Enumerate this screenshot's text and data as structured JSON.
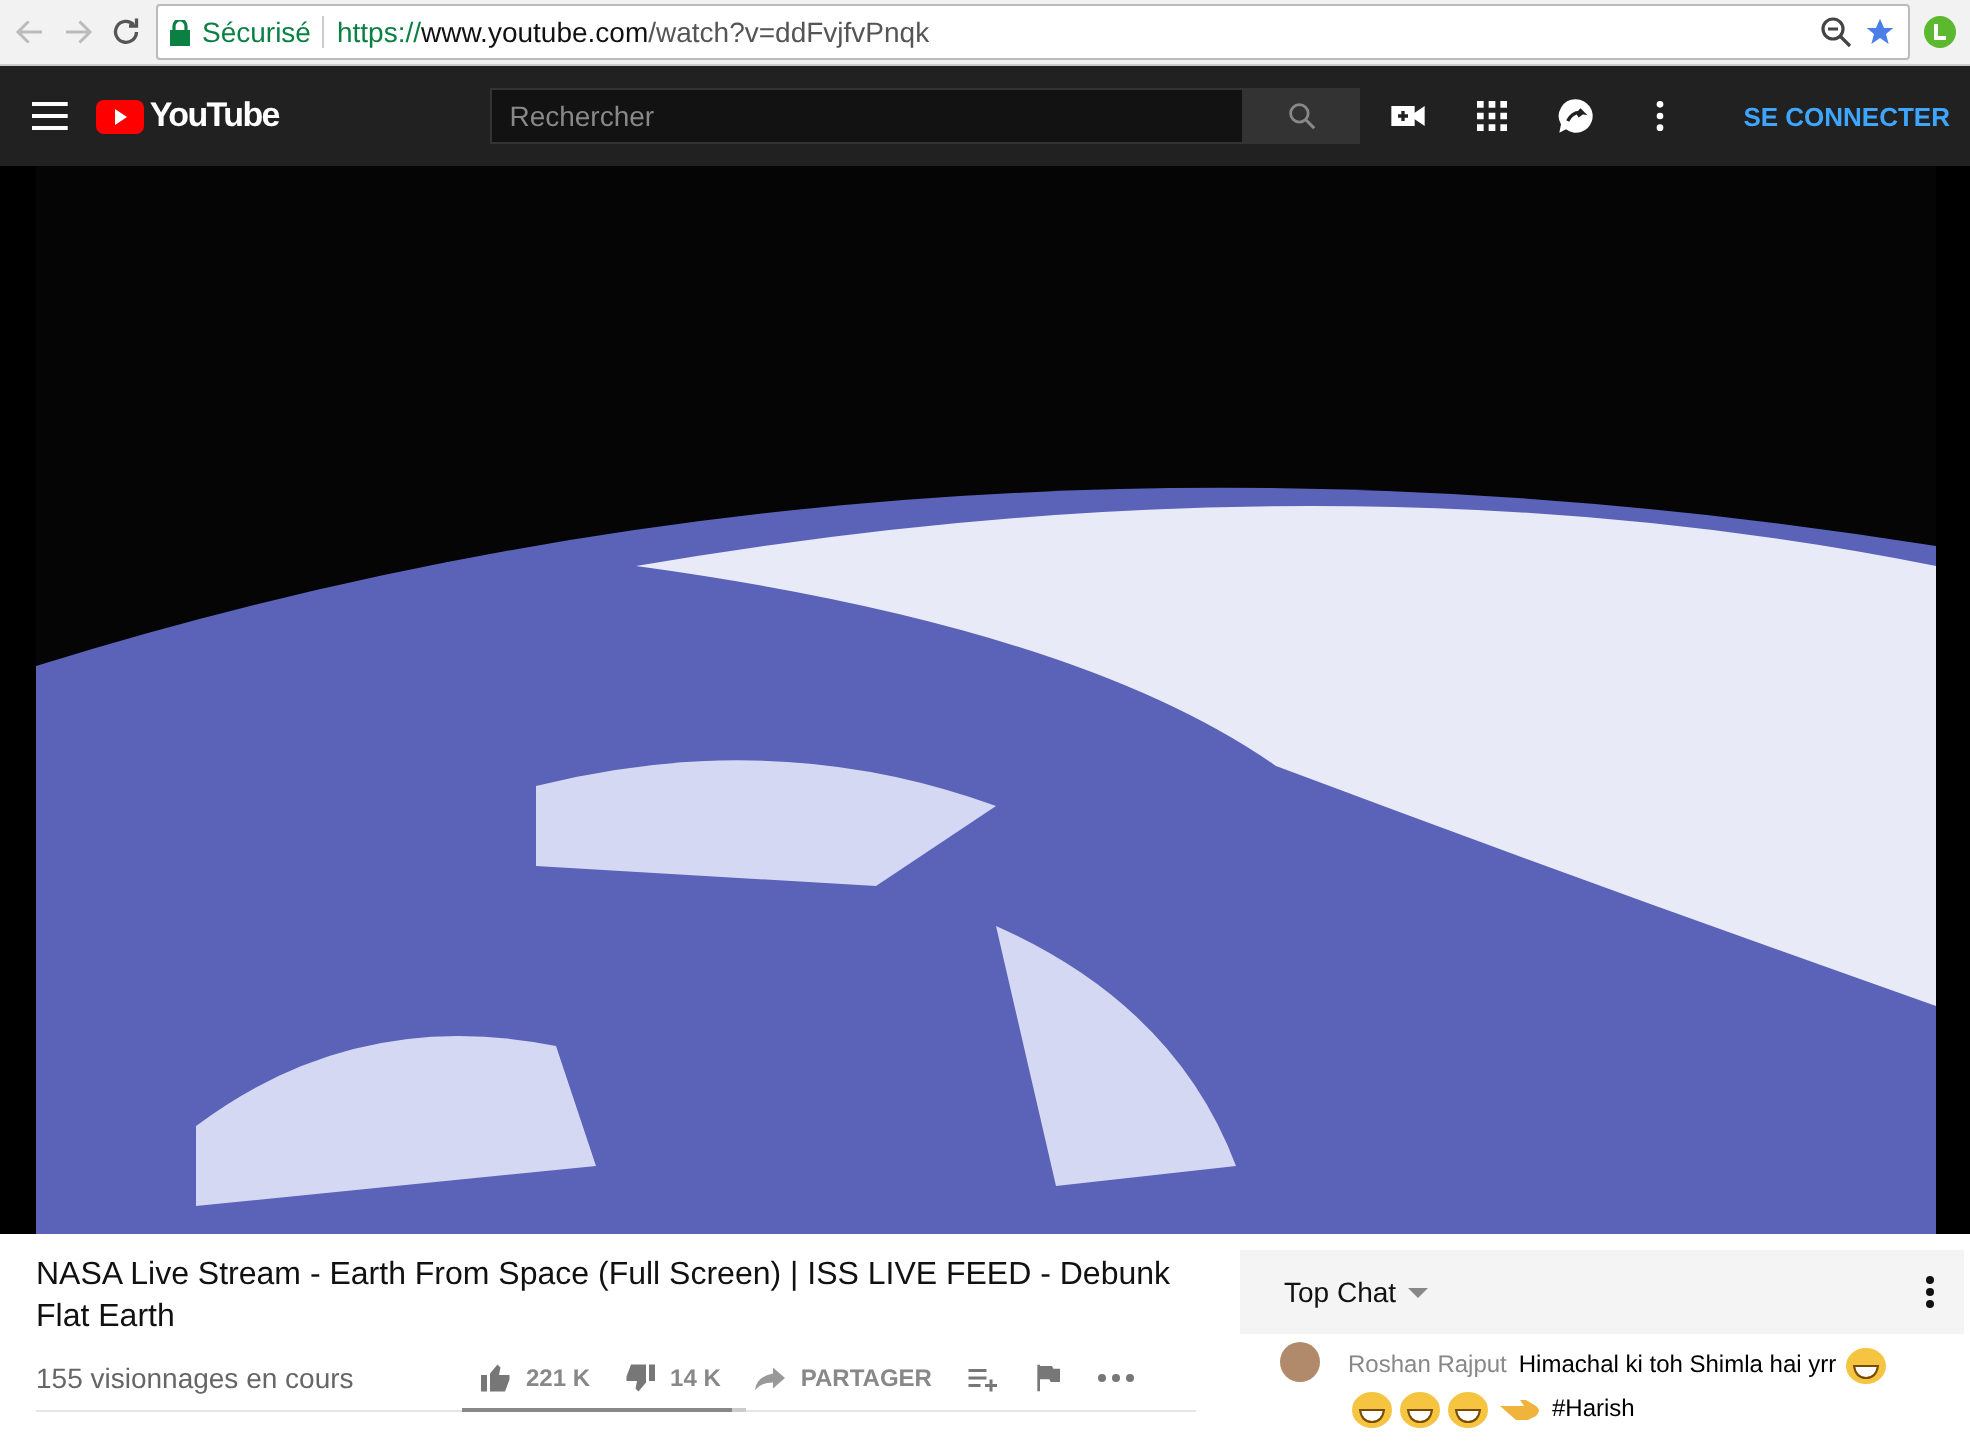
{
  "browser": {
    "secure_label": "Sécurisé",
    "url_scheme": "https://",
    "url_host": "www.youtube.com",
    "url_path": "/watch?v=ddFvjfvPnqk"
  },
  "header": {
    "logo": "YouTube",
    "search": {
      "placeholder": "Rechercher"
    },
    "sign_in": "SE CONNECTER"
  },
  "video": {
    "title": "NASA Live Stream - Earth From Space (Full Screen) | ISS LIVE FEED - Debunk Flat Earth",
    "views": "155 visionnages en cours",
    "likes": "221 K",
    "dislikes": "14 K",
    "like_ratio": {
      "level": 0.95
    },
    "share": "PARTAGER"
  },
  "chat": {
    "header": "Top Chat",
    "messages": [
      {
        "author": "Roshan Rajput",
        "text": "Himachal ki toh Shimla hai yrr",
        "tag": "#Harish"
      }
    ]
  }
}
